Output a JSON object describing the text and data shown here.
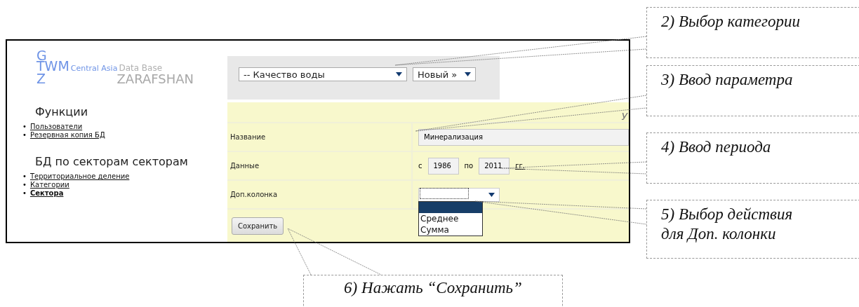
{
  "screenshot": {
    "logo": {
      "top": "G",
      "middle": "TWM",
      "brand": "Central Asia",
      "tail": "Data Base",
      "bottom": "Z",
      "subtitle": "ZARAFSHAN"
    },
    "sidebar": [
      {
        "title": "Функции",
        "bullet": "•",
        "links": [
          {
            "label": "Пользователи",
            "current": false
          },
          {
            "label": "Резервная копия БД",
            "current": false
          }
        ]
      },
      {
        "title": "БД по секторам секторам",
        "bullet": "•",
        "links": [
          {
            "label": "Территориальное деление",
            "current": false
          },
          {
            "label": "Категории",
            "current": false
          },
          {
            "label": "Сектора",
            "current": true
          }
        ]
      }
    ],
    "category_select": "-- Качество воды",
    "action_select": "Новый »",
    "form": {
      "header": "У",
      "rows": [
        {
          "kind": "text",
          "label": "Название",
          "value": "Минерализация"
        },
        {
          "kind": "period",
          "label": "Данные",
          "from_label": "с",
          "from": "1986",
          "to_label": "по",
          "to": "2011",
          "unit": "гг."
        },
        {
          "kind": "select",
          "label": "Доп.колонка",
          "expanded": true,
          "options": [
            {
              "selected": true
            },
            {
              "label": "Среднее",
              "selected": false
            },
            {
              "label": "Сумма",
              "selected": false
            }
          ]
        }
      ],
      "button": "Сохранить"
    }
  },
  "callouts": [
    {
      "lines": [
        "2) Выбор категории"
      ]
    },
    {
      "lines": [
        "3) Ввод параметра"
      ]
    },
    {
      "lines": [
        "4) Ввод периода"
      ]
    },
    {
      "lines": [
        "5) Выбор действия",
        "для Доп. колонки"
      ]
    },
    {
      "lines": [
        "6) Нажать “Сохранить”"
      ]
    }
  ]
}
